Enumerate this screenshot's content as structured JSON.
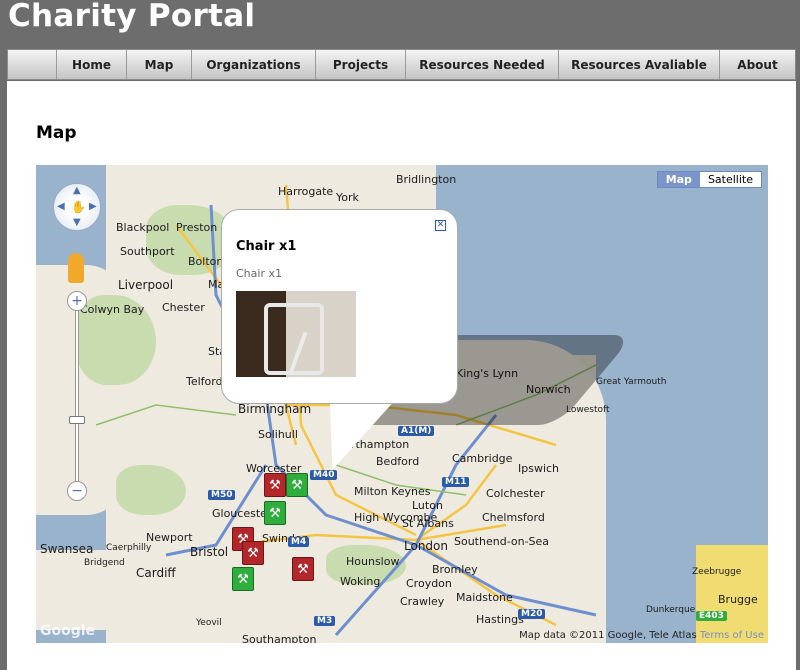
{
  "app": {
    "title": "Charity Portal"
  },
  "nav": {
    "items": [
      {
        "label": "Home"
      },
      {
        "label": "Map"
      },
      {
        "label": "Organizations"
      },
      {
        "label": "Projects"
      },
      {
        "label": "Resources Needed"
      },
      {
        "label": "Resources Avaliable"
      },
      {
        "label": "About"
      }
    ]
  },
  "page": {
    "heading": "Map"
  },
  "map": {
    "type_buttons": {
      "map": "Map",
      "satellite": "Satellite"
    },
    "active_type": "Map",
    "zoom_in": "+",
    "zoom_out": "−",
    "attribution": "Map data ©2011 Google, Tele Atlas",
    "terms": "Terms of Use",
    "logo": "Google",
    "cities": [
      "Harrogate",
      "York",
      "Bridlington",
      "Blackpool",
      "Preston",
      "Southport",
      "Bolton",
      "Liverpool",
      "Colwyn Bay",
      "Chester",
      "Telford",
      "Birmingham",
      "Solihull",
      "Worcester",
      "Northampton",
      "Bedford",
      "Cambridge",
      "Ipswich",
      "Norwich",
      "Great Yarmouth",
      "Lowestoft",
      "King's Lynn",
      "Milton Keynes",
      "Luton",
      "Colchester",
      "High Wycombe",
      "St Albans",
      "Chelmsford",
      "Swansea",
      "Newport",
      "Caerphilly",
      "Cardiff",
      "Bridgend",
      "Bristol",
      "Gloucester",
      "Swindon",
      "London",
      "Southend-on-Sea",
      "Hounslow",
      "Woking",
      "Croydon",
      "Bromley",
      "Crawley",
      "Maidstone",
      "Hastings",
      "Zeebrugge",
      "Dunkerque",
      "Brugge",
      "Yeovil",
      "Southampton",
      "Stafford",
      "Manchester"
    ],
    "roads": [
      "M40",
      "M50",
      "M11",
      "M4",
      "M3",
      "M20",
      "A1(M)",
      "E403"
    ],
    "colors": {
      "sea": "#99b3cc",
      "land": "#efeadf",
      "marker_red": "#b3262a",
      "marker_green": "#2fae3e"
    }
  },
  "popup": {
    "title": "Chair x1",
    "description": "Chair x1",
    "close_icon": "close-icon",
    "image_alt": "chair-photo"
  }
}
